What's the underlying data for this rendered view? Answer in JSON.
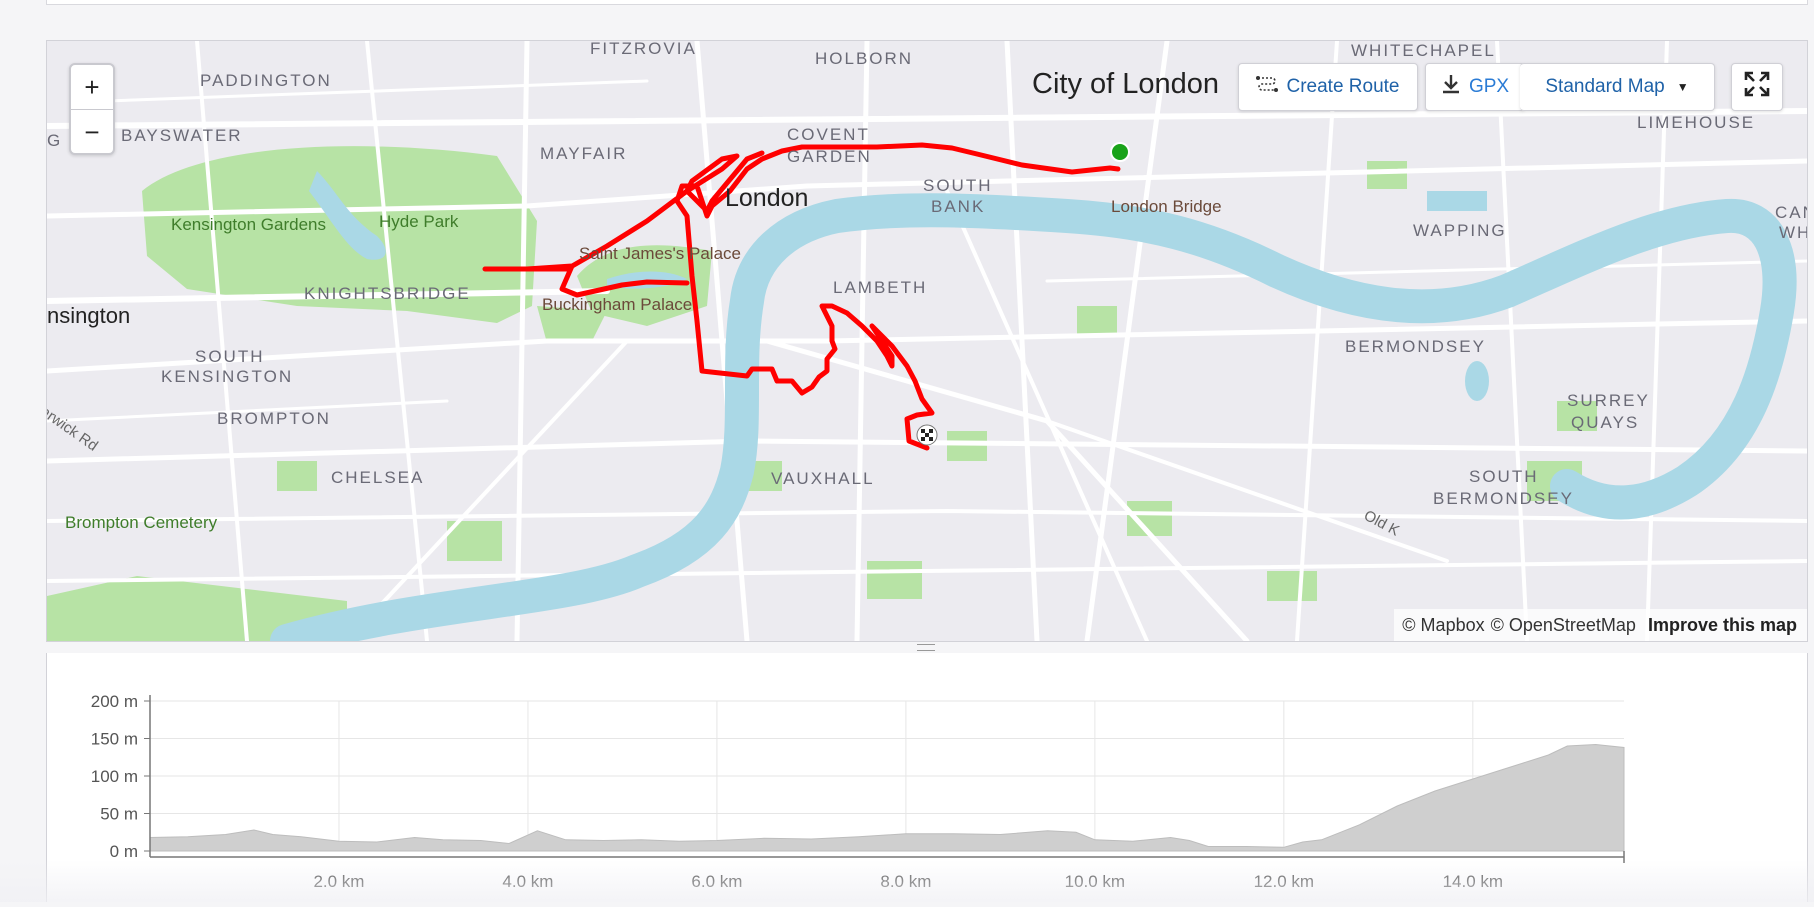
{
  "map": {
    "zoom_in_label": "+",
    "zoom_out_label": "−",
    "create_route_label": "Create Route",
    "create_route_icon": "route-icon",
    "gpx_label": "GPX",
    "gpx_icon": "download-icon",
    "map_style_label": "Standard Map",
    "map_style_icon": "caret-down-icon",
    "fullscreen_icon": "fullscreen-icon",
    "attribution": {
      "mapbox": "© Mapbox",
      "osm": "© OpenStreetMap",
      "improve": "Improve this map"
    },
    "labels": {
      "fitzrovia": "FITZROVIA",
      "holborn": "HOLBORN",
      "whitechapel": "WHITECHAPEL",
      "paddington": "PADDINGTON",
      "city_of_london": "City of London",
      "limehouse": "LIMEHOUSE",
      "bayswater": "BAYSWATER",
      "mayfair": "MAYFAIR",
      "covent": "COVENT",
      "garden": "GARDEN",
      "london": "London",
      "south": "SOUTH",
      "bank": "BANK",
      "london_bridge": "London Bridge",
      "wapping": "WAPPING",
      "canal": "CANAL",
      "whar": "WHAR",
      "kensington_gardens": "Kensington Gardens",
      "hyde_park": "Hyde Park",
      "saint_james_palace": "Saint James's Palace",
      "lambeth": "LAMBETH",
      "knightsbridge": "KNIGHTSBRIDGE",
      "buckingham_palace": "Buckingham Palace",
      "kensington_cut": "nsington",
      "bermondsey": "BERMONDSEY",
      "south_kensington_1": "SOUTH",
      "south_kensington_2": "KENSINGTON",
      "warwick_rd": "arwick Rd",
      "brompton": "BROMPTON",
      "surrey_1": "SURREY",
      "surrey_2": "QUAYS",
      "chelsea": "CHELSEA",
      "vauxhall": "VAUXHALL",
      "south_bermondsey_1": "SOUTH",
      "south_bermondsey_2": "BERMONDSEY",
      "brompton_cemetery": "Brompton Cemetery",
      "old_kent": "Old K",
      "g_cut": "G"
    },
    "route_color": "#ff0000",
    "start_marker_color": "#1aa31a",
    "water_color": "#aad8e6",
    "park_color": "#b7e3a5"
  },
  "chart_data": {
    "type": "area",
    "title": "",
    "xlabel": "",
    "ylabel": "",
    "x_unit": "km",
    "y_unit": "m",
    "xlim": [
      0,
      15.6
    ],
    "ylim": [
      0,
      200
    ],
    "y_ticks": [
      0,
      50,
      100,
      150,
      200
    ],
    "y_tick_labels": [
      "0 m",
      "50 m",
      "100 m",
      "150 m",
      "200 m"
    ],
    "x_ticks": [
      2,
      4,
      6,
      8,
      10,
      12,
      14
    ],
    "x_tick_labels": [
      "2.0 km",
      "4.0 km",
      "6.0 km",
      "8.0 km",
      "10.0 km",
      "12.0 km",
      "14.0 km"
    ],
    "grid": true,
    "series": [
      {
        "x": [
          0,
          0.4,
          0.8,
          1.1,
          1.3,
          1.6,
          2.0,
          2.4,
          2.8,
          3.1,
          3.5,
          3.8,
          4.1,
          4.4,
          4.8,
          5.2,
          5.6,
          6.0,
          6.5,
          7.0,
          7.5,
          8.0,
          8.5,
          9.0,
          9.5,
          9.8,
          10.0,
          10.4,
          10.8,
          11.0,
          11.2,
          11.6,
          12.0,
          12.2,
          12.4,
          12.8,
          13.2,
          13.6,
          14.0,
          14.4,
          14.8,
          15.0,
          15.3,
          15.6
        ],
        "y": [
          18,
          19,
          22,
          28,
          22,
          19,
          13,
          12,
          18,
          15,
          14,
          10,
          27,
          15,
          14,
          15,
          13,
          14,
          17,
          16,
          19,
          23,
          23,
          22,
          27,
          25,
          15,
          13,
          18,
          14,
          6,
          6,
          5,
          12,
          15,
          35,
          60,
          80,
          96,
          112,
          128,
          140,
          142,
          138
        ]
      }
    ]
  }
}
